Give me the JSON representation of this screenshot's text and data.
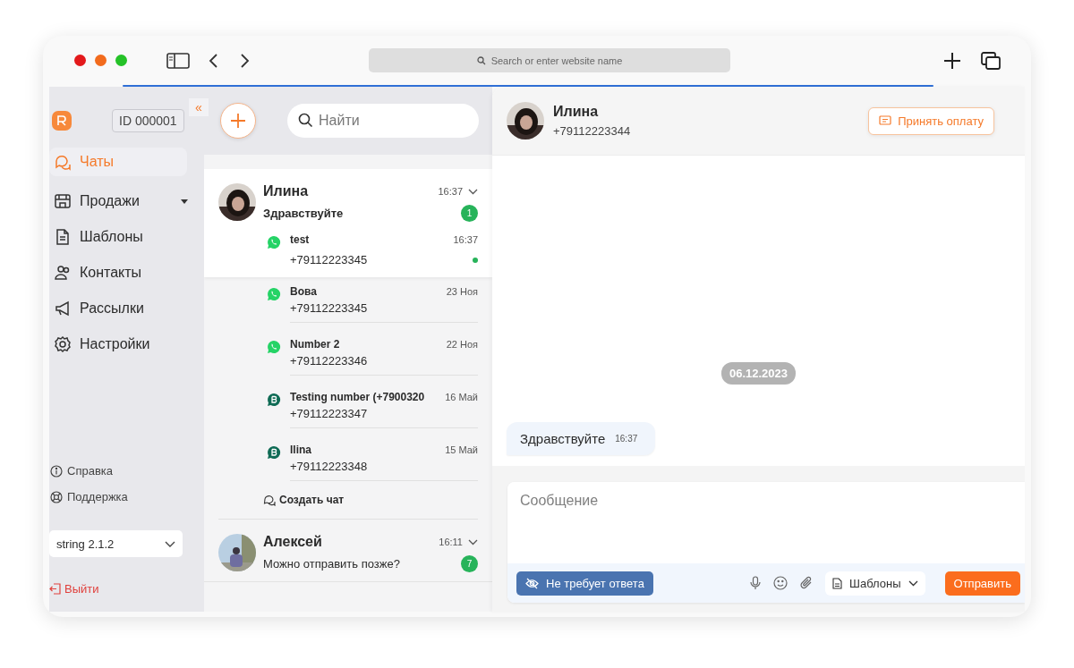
{
  "browser": {
    "address_placeholder": "Search or enter website name"
  },
  "sidebar": {
    "account_id": "ID 000001",
    "collapse": "«",
    "nav": [
      {
        "label": "Чаты",
        "selected": true,
        "has_caret": false
      },
      {
        "label": "Продажи",
        "selected": false,
        "has_caret": true
      },
      {
        "label": "Шаблоны",
        "selected": false,
        "has_caret": false
      },
      {
        "label": "Контакты",
        "selected": false,
        "has_caret": false
      },
      {
        "label": "Рассылки",
        "selected": false,
        "has_caret": false
      },
      {
        "label": "Настройки",
        "selected": false,
        "has_caret": false
      }
    ],
    "links": [
      "Справка",
      "Поддержка"
    ],
    "version": "string 2.1.2",
    "logout": "Выйти"
  },
  "chat_list": {
    "search_placeholder": "Найти",
    "chats": [
      {
        "name": "Илина",
        "time": "16:37",
        "preview": "Здравствуйте",
        "unread": "1",
        "expanded": true,
        "create_chat": "Создать чат",
        "children": [
          {
            "kind": "whatsapp",
            "name": "test",
            "phone": "+79112223345",
            "time": "16:37",
            "selected": true,
            "online": true
          },
          {
            "kind": "whatsapp",
            "name": "Вова",
            "phone": "+79112223345",
            "time": "23 Ноя",
            "selected": false,
            "online": false
          },
          {
            "kind": "whatsapp",
            "name": "Number 2",
            "phone": "+79112223346",
            "time": "22 Ноя",
            "selected": false,
            "online": false
          },
          {
            "kind": "business",
            "name": "Testing number (+7900320",
            "phone": "+79112223347",
            "time": "16 Май",
            "selected": false,
            "online": false
          },
          {
            "kind": "business",
            "name": "Ilina",
            "phone": "+79112223348",
            "time": "15 Май",
            "selected": false,
            "online": false
          }
        ]
      },
      {
        "name": "Алексей",
        "time": "16:11",
        "preview": "Можно отправить позже?",
        "unread": "7",
        "expanded": false
      }
    ]
  },
  "chat": {
    "name": "Илина",
    "phone": "+79112223344",
    "pay_button": "Принять оплату",
    "date": "06.12.2023",
    "messages": [
      {
        "text": "Здравствуйте",
        "time": "16:37"
      }
    ],
    "composer": {
      "placeholder": "Сообщение",
      "no_reply_button": "Не требует ответа",
      "templates": "Шаблоны",
      "send": "Отправить"
    }
  }
}
